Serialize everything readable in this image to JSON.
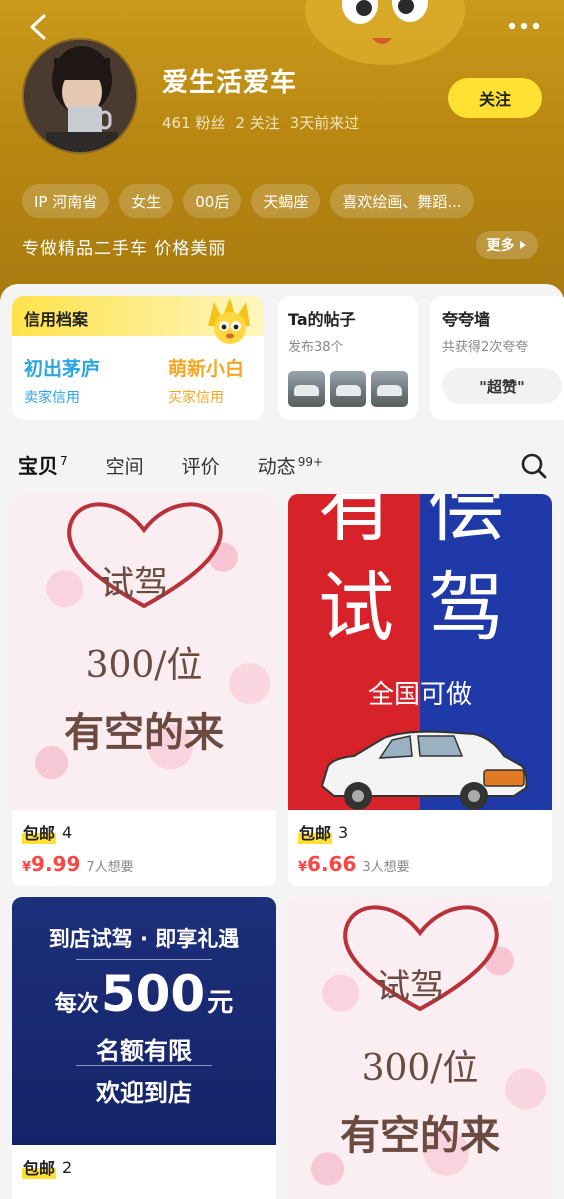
{
  "header": {
    "nickname": "爱生活爱车",
    "fans": "461 粉丝",
    "following": "2 关注",
    "last_seen": "3天前来过",
    "follow_label": "关注",
    "tags": [
      "IP 河南省",
      "女生",
      "00后",
      "天蝎座",
      "喜欢绘画、舞蹈..."
    ],
    "bio": "专做精品二手车 价格美丽",
    "more_label": "更多"
  },
  "credit": {
    "title": "信用档案",
    "seller_level": "初出茅庐",
    "seller_label": "卖家信用",
    "buyer_level": "萌新小白",
    "buyer_label": "买家信用"
  },
  "posts": {
    "title": "Ta的帖子",
    "count": "发布38个"
  },
  "praise": {
    "title": "夸夸墙",
    "count": "共获得2次夸夸",
    "button": "\"超赞\""
  },
  "tabs": [
    {
      "label": "宝贝",
      "badge": "7"
    },
    {
      "label": "空间",
      "badge": ""
    },
    {
      "label": "评价",
      "badge": ""
    },
    {
      "label": "动态",
      "badge": "99+"
    }
  ],
  "products": [
    {
      "ship": "包邮",
      "qty": "4",
      "price_symbol": "¥",
      "price": "9.99",
      "wants": "7人想要",
      "poster": {
        "line1": "试驾",
        "line2": "300/位",
        "line3": "有空的来"
      }
    },
    {
      "ship": "包邮",
      "qty": "3",
      "price_symbol": "¥",
      "price": "6.66",
      "wants": "3人想要",
      "poster": {
        "left_top": "有",
        "right_top": "偿",
        "left_mid": "试",
        "right_mid": "驾",
        "sub": "全国可做"
      }
    },
    {
      "ship": "包邮",
      "qty": "2",
      "price_symbol": "",
      "price": "",
      "wants": "",
      "poster": {
        "line1": "到店试驾 · 即享礼遇",
        "line2a": "每次",
        "line2b": "500",
        "line2c": "元",
        "line3": "名额有限",
        "line4": "欢迎到店"
      }
    },
    {
      "ship": "",
      "qty": "",
      "price_symbol": "",
      "price": "",
      "wants": "",
      "poster": {
        "line1": "试驾",
        "line2": "300/位",
        "line3": "有空的来"
      }
    }
  ],
  "colors": {
    "accent": "#ffe033",
    "price": "#ff4444",
    "seller_credit": "#2aa6e0",
    "buyer_credit": "#f5a623"
  },
  "icons": [
    "back-arrow-icon",
    "more-dots-icon",
    "search-icon",
    "chevron-right-icon",
    "mascot-icon"
  ]
}
